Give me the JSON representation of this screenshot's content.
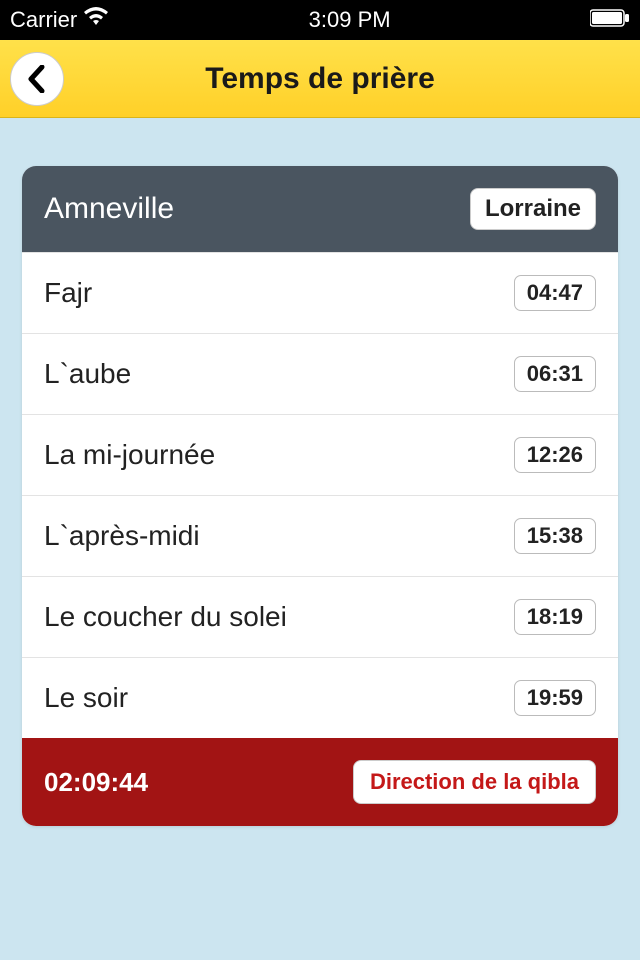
{
  "statusBar": {
    "carrier": "Carrier",
    "time": "3:09 PM"
  },
  "header": {
    "title": "Temps de prière"
  },
  "location": {
    "city": "Amneville",
    "region": "Lorraine"
  },
  "prayers": [
    {
      "name": "Fajr",
      "time": "04:47"
    },
    {
      "name": "L`aube",
      "time": "06:31"
    },
    {
      "name": "La mi-journée",
      "time": "12:26"
    },
    {
      "name": "L`après-midi",
      "time": "15:38"
    },
    {
      "name": "Le coucher du solei",
      "time": "18:19"
    },
    {
      "name": "Le soir",
      "time": "19:59"
    }
  ],
  "footer": {
    "countdown": "02:09:44",
    "qiblaLabel": "Direction de la qibla"
  }
}
